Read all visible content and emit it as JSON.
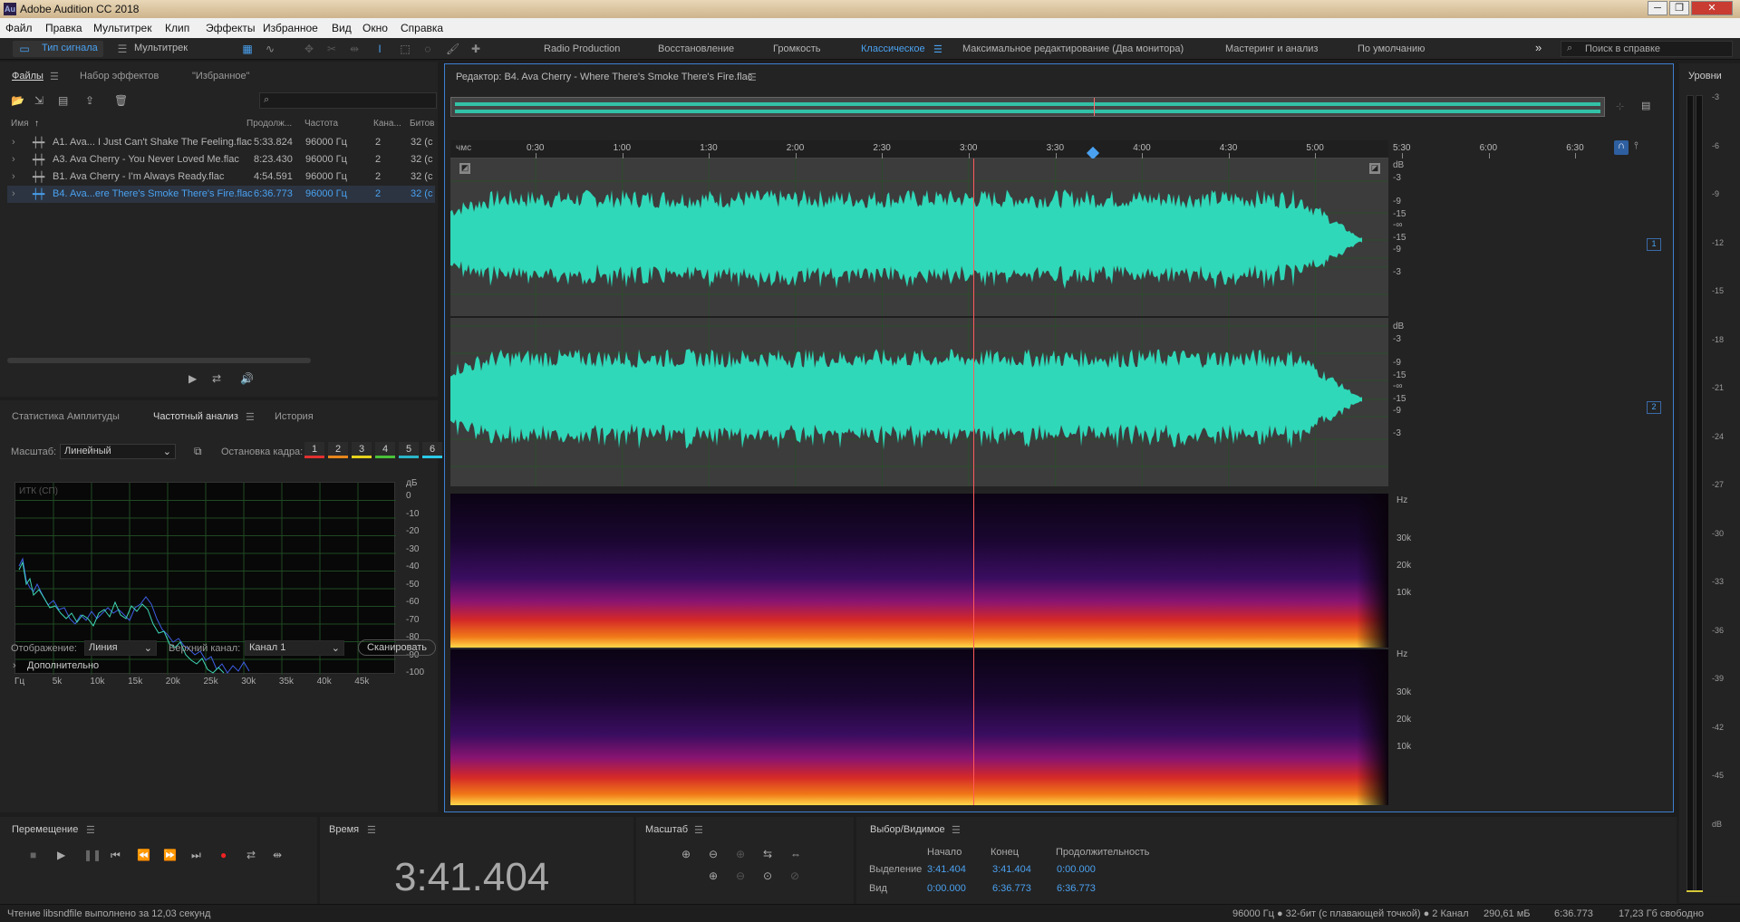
{
  "app": {
    "title": "Adobe Audition CC 2018",
    "icon_text": "Au"
  },
  "window_controls": {
    "minimize": "─",
    "restore": "❐",
    "close": "✕"
  },
  "menu": [
    "Файл",
    "Правка",
    "Мультитрек",
    "Клип",
    "Эффекты",
    "Избранное",
    "Вид",
    "Окно",
    "Справка"
  ],
  "toolbar": {
    "waveform_tab": "Тип сигнала",
    "multitrack_tab": "Мультитрек",
    "workspaces": [
      "Radio Production",
      "Восстановление",
      "Громкость",
      "Классическое",
      "Максимальное редактирование (Два монитора)",
      "Мастеринг и анализ",
      "По умолчанию"
    ],
    "active_workspace": "Классическое",
    "more": "»",
    "search_placeholder": "Поиск в справке"
  },
  "files_panel": {
    "tabs": [
      "Файлы",
      "Набор эффектов",
      "\"Избранное\""
    ],
    "columns": [
      "Имя",
      "Продолж...",
      "Частота",
      "Кана...",
      "Битов"
    ],
    "rows": [
      {
        "name": "A1. Ava... I Just Can't Shake The Feeling.flac",
        "duration": "5:33.824",
        "rate": "96000 Гц",
        "channels": "2",
        "bits": "32 (с"
      },
      {
        "name": "A3. Ava Cherry - You Never Loved Me.flac",
        "duration": "8:23.430",
        "rate": "96000 Гц",
        "channels": "2",
        "bits": "32 (с"
      },
      {
        "name": "B1. Ava Cherry - I'm Always Ready.flac",
        "duration": "4:54.591",
        "rate": "96000 Гц",
        "channels": "2",
        "bits": "32 (с"
      },
      {
        "name": "B4. Ava...ere There's Smoke There's Fire.flac",
        "duration": "6:36.773",
        "rate": "96000 Гц",
        "channels": "2",
        "bits": "32 (с"
      }
    ],
    "selected_row": 3
  },
  "analysis_panel": {
    "tabs": [
      "Статистика Амплитуды",
      "Частотный анализ",
      "История"
    ],
    "scale_label": "Масштаб:",
    "scale_value": "Линейный",
    "freeze_label": "Остановка кадра:",
    "freeze_buttons": [
      "1",
      "2",
      "3",
      "4",
      "5",
      "6"
    ],
    "freeze_colors": [
      "#e23030",
      "#e8861c",
      "#e6d21c",
      "#4ac23a",
      "#2bb5c8",
      "#2bc9e8"
    ],
    "plot_label": "ИТК (СП)",
    "db_label": "дБ",
    "db_ticks": [
      "0",
      "-10",
      "-20",
      "-30",
      "-40",
      "-50",
      "-60",
      "-70",
      "-80",
      "-90",
      "-100"
    ],
    "freq_ticks": [
      "Гц",
      "5k",
      "10k",
      "15k",
      "20k",
      "25k",
      "30k",
      "35k",
      "40k",
      "45k"
    ],
    "display_label": "Отображение:",
    "display_value": "Линия",
    "channel_label": "Верхний канал:",
    "channel_value": "Канал 1",
    "scan_button": "Сканировать",
    "advanced": "Дополнительно"
  },
  "editor": {
    "title": "Редактор: B4. Ava Cherry - Where There's Smoke There's Fire.flac",
    "ruler_unit": "чмс",
    "ruler_ticks": [
      "0:30",
      "1:00",
      "1:30",
      "2:00",
      "2:30",
      "3:00",
      "3:30",
      "4:00",
      "4:30",
      "5:00",
      "5:30",
      "6:00",
      "6:30"
    ],
    "db_scale_ch1": [
      "dB",
      "-3",
      "-9",
      "-15",
      "-∞",
      "-15",
      "-9",
      "-3"
    ],
    "db_scale_ch2": [
      "dB",
      "-3",
      "-9",
      "-15",
      "-∞",
      "-15",
      "-9",
      "-3"
    ],
    "channel_badges": [
      "1",
      "2"
    ],
    "hz_scale": [
      "Hz",
      "30k",
      "20k",
      "10k"
    ],
    "playhead_fraction": 0.5574,
    "waveform_color": "#2fd8b8"
  },
  "levels": {
    "title": "Уровни",
    "ticks": [
      "-3",
      "-6",
      "-9",
      "-12",
      "-15",
      "-18",
      "-21",
      "-24",
      "-27",
      "-30",
      "-33",
      "-36",
      "-39",
      "-42",
      "-45",
      "dB"
    ]
  },
  "transport": {
    "title": "Перемещение"
  },
  "time": {
    "title": "Время",
    "value": "3:41.404"
  },
  "zoom": {
    "title": "Масштаб"
  },
  "selection": {
    "title": "Выбор/Видимое",
    "col_start": "Начало",
    "col_end": "Конец",
    "col_duration": "Продолжительность",
    "row_selection": "Выделение",
    "row_view": "Вид",
    "sel_start": "3:41.404",
    "sel_end": "3:41.404",
    "sel_duration": "0:00.000",
    "view_start": "0:00.000",
    "view_end": "6:36.773",
    "view_duration": "6:36.773"
  },
  "status": {
    "left": "Чтение libsndfile выполнено за 12,03 секунд",
    "format": "96000 Гц ● 32-бит (с плавающей точкой) ● 2 Канал",
    "size": "290,61 мБ",
    "duration": "6:36.773",
    "free": "17,23 Гб свободно"
  }
}
